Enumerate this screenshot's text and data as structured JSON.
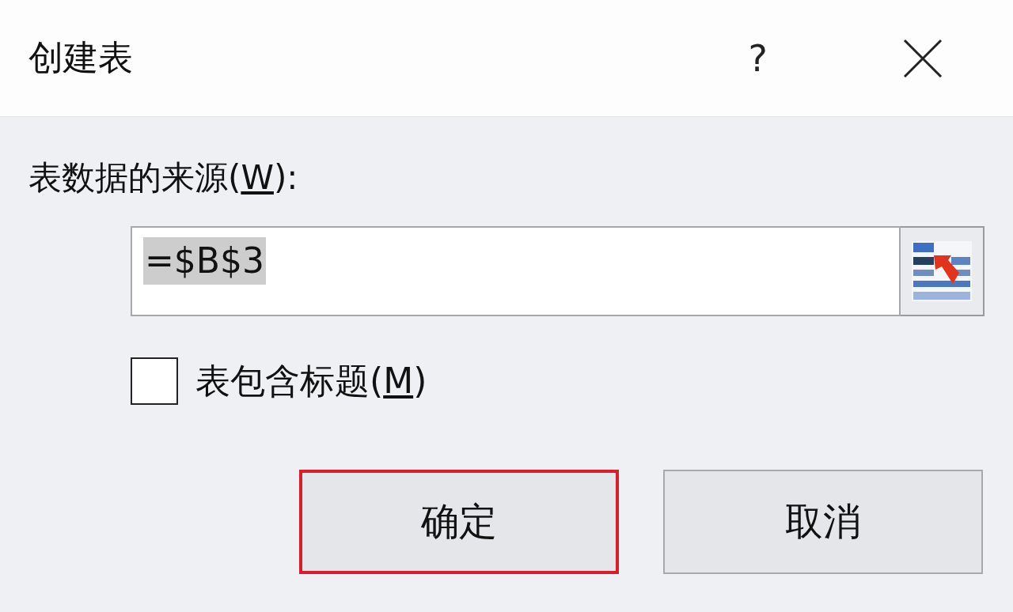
{
  "window": {
    "title": "创建表",
    "help": "?"
  },
  "source": {
    "label": {
      "before": "表数据的来源(",
      "key": "W",
      "after": "):"
    },
    "value": "=$B$3",
    "value_selected": true
  },
  "header_option": {
    "label": {
      "before": "表包含标题(",
      "key": "M",
      "after": ")"
    },
    "checked": false
  },
  "buttons": [
    {
      "label": "确定",
      "highlighted": true
    },
    {
      "label": "取消",
      "highlighted": false
    }
  ]
}
